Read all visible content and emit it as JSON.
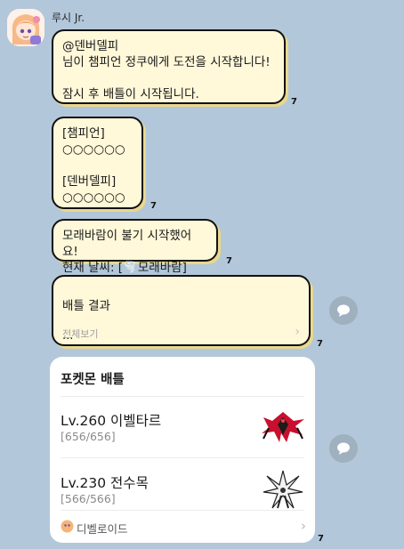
{
  "sender": {
    "name": "루시 Jr."
  },
  "messages": {
    "m1": {
      "text": "@덴버델피\n님이 챔피언 정쿠에게 도전을 시작합니다!\n\n잠시 후 배틀이 시작됩니다.",
      "unread": "7"
    },
    "m2": {
      "text": "[챔피언]\n○○○○○○\n\n[덴버델피]\n○○○○○○",
      "unread": "7"
    },
    "m3": {
      "text": "모래바람이 불기 시작했어요!\n현재 날씨: [🌪️모래바람]",
      "unread": "7"
    },
    "m4": {
      "title": "배틀 결과",
      "dots": "...",
      "more": "전체보기",
      "unread": "7"
    }
  },
  "card": {
    "title": "포켓몬 배틀",
    "pokemon": [
      {
        "name": "Lv.260 이벨타르",
        "hp": "[656/656]",
        "sprite": "yveltal"
      },
      {
        "name": "Lv.230 전수목",
        "hp": "[566/566]",
        "sprite": "kartana"
      }
    ],
    "footer": "디벨로이드",
    "unread": "7"
  },
  "colors": {
    "background": "#b2c7da",
    "bubble": "#fff8d9",
    "shadow": "#e8d88e"
  }
}
